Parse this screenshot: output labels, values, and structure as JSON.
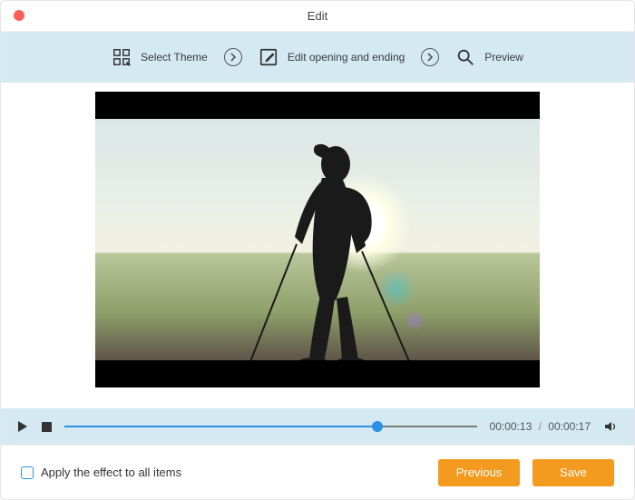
{
  "window": {
    "title": "Edit"
  },
  "steps": {
    "theme": "Select Theme",
    "opening": "Edit opening and ending",
    "preview": "Preview"
  },
  "playback": {
    "current_time": "00:00:13",
    "total_time": "00:00:17",
    "separator": "/",
    "progress_pct": 76
  },
  "footer": {
    "apply_all_label": "Apply the effect to all items",
    "apply_all_checked": false,
    "previous_label": "Previous",
    "save_label": "Save"
  },
  "colors": {
    "accent": "#2b8fe5",
    "panel": "#d5e9f3",
    "primary_btn": "#f39a1f"
  }
}
